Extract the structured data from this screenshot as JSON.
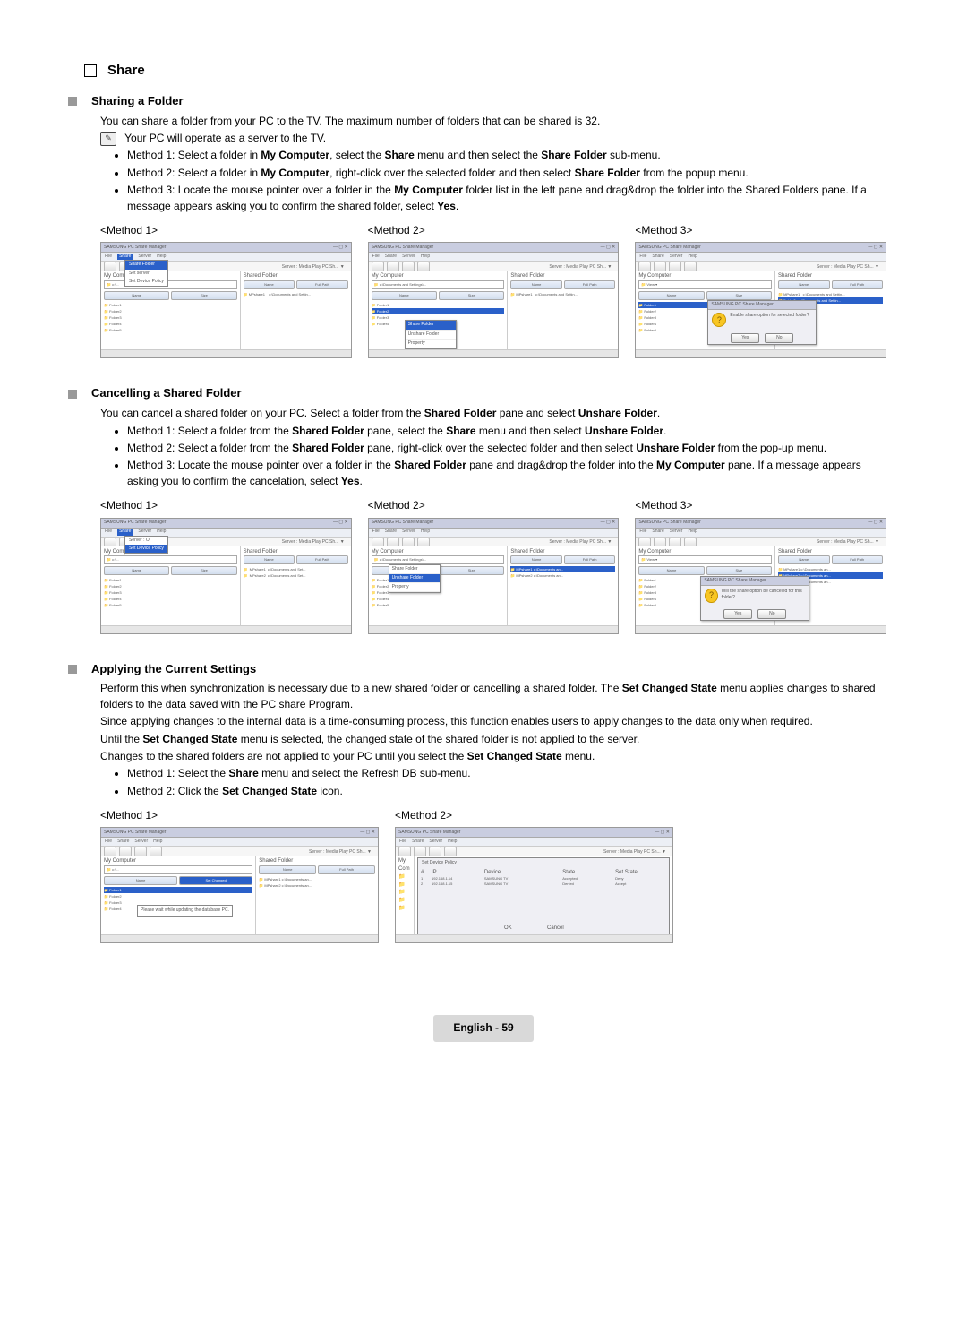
{
  "heading": "Share",
  "footer": "English - 59",
  "shot_common": {
    "app_title": "SAMSUNG PC Share Manager",
    "menus": [
      "File",
      "Share",
      "Server",
      "Help"
    ],
    "server_label": "Server : Media Play PC Sh... ▼",
    "right_heading": "Shared Folder",
    "hd_name": "Name",
    "hd_size": "Size",
    "hd_fullpath": "Full Path",
    "my_computer": "My Computer"
  },
  "sharing": {
    "title": "Sharing a Folder",
    "intro": "You can share a folder from your PC to the TV. The maximum number of folders that can be shared is 32.",
    "note": "Your PC will operate as a server to the TV.",
    "bullets": [
      {
        "pre": "Method 1: Select a folder in ",
        "b1": "My Computer",
        "mid": ", select the ",
        "b2": "Share",
        "mid2": " menu and then select the ",
        "b3": "Share Folder",
        "post": " sub-menu."
      },
      {
        "pre": "Method 2: Select a folder in ",
        "b1": "My Computer",
        "mid": ", right-click over the selected folder and then select ",
        "b2": "Share Folder",
        "post": " from the popup menu."
      },
      {
        "pre": "Method 3: Locate the mouse pointer over a folder in the ",
        "b1": "My Computer",
        "mid": " folder list in the left pane and drag&drop the folder into the Shared Folders pane. If a message appears asking you to confirm the shared folder, select ",
        "b2": "Yes",
        "post": "."
      }
    ],
    "m1": "<Method 1>",
    "m2": "<Method 2>",
    "m3": "<Method 3>",
    "ctx_share": "Share Folder",
    "ctx_unshare": "Unshare Folder",
    "ctx_property": "Property",
    "dlg_title": "SAMSUNG PC Share Manager",
    "dlg_msg": "Enable share option for selected folder?",
    "yes": "Yes",
    "no": "No",
    "share_menu_sub": "Share Folder",
    "set_srv": "Set server",
    "share_paths": "c:\\Documents and Settin..."
  },
  "cancelling": {
    "title": "Cancelling a Shared Folder",
    "intro_pre": "You can cancel a shared folder on your PC. Select a folder from the ",
    "intro_b": "Shared Folder",
    "intro_mid": " pane and select ",
    "intro_b2": "Unshare Folder",
    "intro_post": ".",
    "bullets": [
      {
        "pre": "Method 1: Select a folder from the ",
        "b1": "Shared Folder",
        "mid": " pane, select the ",
        "b2": "Share",
        "mid2": " menu and then select ",
        "b3": "Unshare Folder",
        "post": "."
      },
      {
        "pre": "Method 2: Select a folder from the ",
        "b1": "Shared Folder",
        "mid": " pane, right-click over the selected folder and then select ",
        "b2": "Unshare Folder",
        "post": " from the pop-up menu."
      },
      {
        "pre": "Method 3: Locate the mouse pointer over a folder in the ",
        "b1": "Shared Folder",
        "mid": " pane and drag&drop the folder into the ",
        "b2": "My Computer",
        "post": " pane. If a message appears asking you to confirm the cancelation, select ",
        "b3": "Yes",
        "post2": "."
      }
    ],
    "m1": "<Method 1>",
    "m2": "<Method 2>",
    "m3": "<Method 3>",
    "dlg_msg": "Will the share option be canceled for this folder?",
    "folders": [
      "MPshare1",
      "MPshare2",
      "MPshare3"
    ]
  },
  "applying": {
    "title": "Applying the Current Settings",
    "p1_pre": "Perform this when synchronization is necessary due to a new shared folder or cancelling a shared folder. The ",
    "p1_b": "Set Changed State",
    "p1_post": " menu applies changes to shared folders to the data saved with the PC share Program.",
    "p2": "Since applying changes to the internal data is a time-consuming process, this function enables users to apply changes to the data only when required.",
    "p3_pre": "Until the ",
    "p3_b": "Set Changed State",
    "p3_post": " menu is selected, the changed state of the shared folder is not applied to the server.",
    "p4_pre": "Changes to the shared folders are not applied to your PC until you select the ",
    "p4_b": "Set Changed State",
    "p4_post": " menu.",
    "bullets": [
      {
        "pre": "Method 1: Select the ",
        "b1": "Share",
        "post": " menu and select the Refresh DB sub-menu."
      },
      {
        "pre": "Method 2: Click the ",
        "b1": "Set Changed State",
        "post": " icon."
      }
    ],
    "m1": "<Method 1>",
    "m2": "<Method 2>",
    "refresh": "Please wait while updating the database PC.",
    "policy": "Set Device Policy",
    "btn_ok": "OK",
    "btn_cancel": "Cancel",
    "col_ip": "IP",
    "col_device": "Device",
    "col_state": "State",
    "col_setstate": "Set State",
    "deny": "Deny",
    "accept": "Accept"
  }
}
